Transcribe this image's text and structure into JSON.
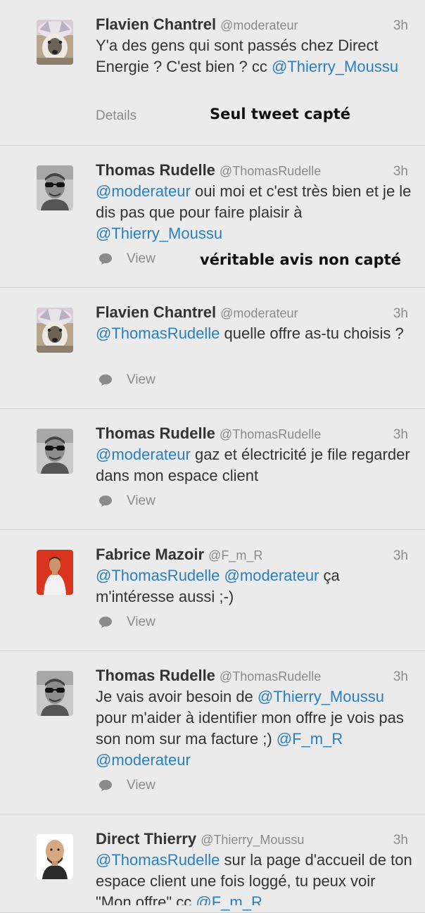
{
  "tweets": [
    {
      "name": "Flavien Chantrel",
      "handle": "@moderateur",
      "time": "3h",
      "segments": [
        {
          "t": "Y'a des gens qui sont passés chez Direct Energie ? C'est bien ? cc "
        },
        {
          "t": "@Thierry_Moussu",
          "m": true
        }
      ],
      "action": "Details",
      "action_icon": "none",
      "note": "Seul tweet capté",
      "avatar": "husky-avatar"
    },
    {
      "name": "Thomas Rudelle",
      "handle": "@ThomasRudelle",
      "time": "3h",
      "segments": [
        {
          "t": "@moderateur",
          "m": true
        },
        {
          "t": " oui moi et c'est très bien et je le dis pas que pour faire plaisir à "
        },
        {
          "t": "@Thierry_Moussu",
          "m": true
        }
      ],
      "action": "View",
      "action_icon": "speech-bubble-icon",
      "note": "véritable avis non capté",
      "avatar": "sunglasses-avatar"
    },
    {
      "name": "Flavien Chantrel",
      "handle": "@moderateur",
      "time": "3h",
      "segments": [
        {
          "t": "@ThomasRudelle",
          "m": true
        },
        {
          "t": " quelle offre as-tu choisis ?"
        }
      ],
      "action": "View",
      "action_icon": "speech-bubble-icon",
      "note": "",
      "avatar": "husky-avatar"
    },
    {
      "name": "Thomas Rudelle",
      "handle": "@ThomasRudelle",
      "time": "3h",
      "segments": [
        {
          "t": "@moderateur",
          "m": true
        },
        {
          "t": " gaz et électricité je file regarder dans mon espace client"
        }
      ],
      "action": "View",
      "action_icon": "speech-bubble-icon",
      "note": "",
      "avatar": "sunglasses-avatar"
    },
    {
      "name": "Fabrice Mazoir",
      "handle": "@F_m_R",
      "time": "3h",
      "segments": [
        {
          "t": "@ThomasRudelle",
          "m": true
        },
        {
          "t": " "
        },
        {
          "t": "@moderateur",
          "m": true
        },
        {
          "t": " ça m'intéresse aussi ;-)"
        }
      ],
      "action": "View",
      "action_icon": "speech-bubble-icon",
      "note": "",
      "avatar": "red-background-avatar"
    },
    {
      "name": "Thomas Rudelle",
      "handle": "@ThomasRudelle",
      "time": "3h",
      "segments": [
        {
          "t": "Je vais avoir besoin de "
        },
        {
          "t": "@Thierry_Moussu",
          "m": true
        },
        {
          "t": " pour m'aider à identifier mon offre je vois pas son nom sur ma facture ;) "
        },
        {
          "t": "@F_m_R",
          "m": true
        },
        {
          "t": " "
        },
        {
          "t": "@moderateur",
          "m": true
        }
      ],
      "action": "View",
      "action_icon": "speech-bubble-icon",
      "note": "",
      "avatar": "sunglasses-avatar"
    },
    {
      "name": "Direct Thierry",
      "handle": "@Thierry_Moussu",
      "time": "3h",
      "segments": [
        {
          "t": "@ThomasRudelle",
          "m": true
        },
        {
          "t": " sur la page d'accueil de ton espace client une fois loggé, tu peux voir \"Mon offre\" cc "
        },
        {
          "t": "@F_m_R",
          "m": true
        }
      ],
      "action": "",
      "action_icon": "none",
      "note": "",
      "avatar": "bald-man-avatar"
    }
  ]
}
